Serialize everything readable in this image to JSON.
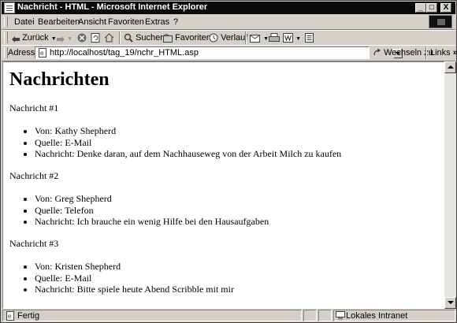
{
  "window": {
    "title": "Nachricht - HTML - Microsoft Internet Explorer",
    "buttons": [
      "_",
      "□",
      "X"
    ]
  },
  "menu": [
    "Datei",
    "Bearbeiten",
    "Ansicht",
    "Favoriten",
    "Extras",
    "?"
  ],
  "toolbar": {
    "back": "Zurück",
    "search": "Suchen",
    "favorites": "Favoriten",
    "history": "Verlauf"
  },
  "address": {
    "label": "Adresse",
    "url": "http://localhost/tag_19/nchr_HTML.asp",
    "go": "Wechseln zu",
    "links": "Links"
  },
  "page": {
    "heading": "Nachrichten",
    "messages": [
      {
        "title": "Nachricht #1",
        "from": "Von: Kathy Shepherd",
        "source": "Quelle: E-Mail",
        "text": "Nachricht: Denke daran, auf dem Nachhauseweg von der Arbeit Milch zu kaufen"
      },
      {
        "title": "Nachricht #2",
        "from": "Von: Greg Shepherd",
        "source": "Quelle: Telefon",
        "text": "Nachricht: Ich brauche ein wenig Hilfe bei den Hausaufgaben"
      },
      {
        "title": "Nachricht #3",
        "from": "Von: Kristen Shepherd",
        "source": "Quelle: E-Mail",
        "text": "Nachricht: Bitte spiele heute Abend Scribble mit mir"
      }
    ]
  },
  "status": {
    "text": "Fertig",
    "zone": "Lokales Intranet"
  }
}
